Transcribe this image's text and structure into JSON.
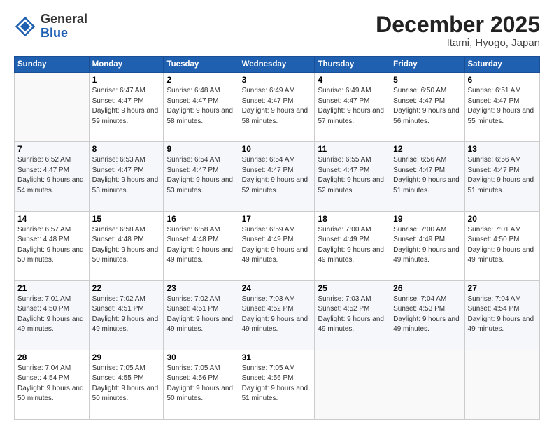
{
  "header": {
    "logo_general": "General",
    "logo_blue": "Blue",
    "month_title": "December 2025",
    "location": "Itami, Hyogo, Japan"
  },
  "weekdays": [
    "Sunday",
    "Monday",
    "Tuesday",
    "Wednesday",
    "Thursday",
    "Friday",
    "Saturday"
  ],
  "weeks": [
    [
      {
        "day": "",
        "sunrise": "",
        "sunset": "",
        "daylight": ""
      },
      {
        "day": "1",
        "sunrise": "Sunrise: 6:47 AM",
        "sunset": "Sunset: 4:47 PM",
        "daylight": "Daylight: 9 hours and 59 minutes."
      },
      {
        "day": "2",
        "sunrise": "Sunrise: 6:48 AM",
        "sunset": "Sunset: 4:47 PM",
        "daylight": "Daylight: 9 hours and 58 minutes."
      },
      {
        "day": "3",
        "sunrise": "Sunrise: 6:49 AM",
        "sunset": "Sunset: 4:47 PM",
        "daylight": "Daylight: 9 hours and 58 minutes."
      },
      {
        "day": "4",
        "sunrise": "Sunrise: 6:49 AM",
        "sunset": "Sunset: 4:47 PM",
        "daylight": "Daylight: 9 hours and 57 minutes."
      },
      {
        "day": "5",
        "sunrise": "Sunrise: 6:50 AM",
        "sunset": "Sunset: 4:47 PM",
        "daylight": "Daylight: 9 hours and 56 minutes."
      },
      {
        "day": "6",
        "sunrise": "Sunrise: 6:51 AM",
        "sunset": "Sunset: 4:47 PM",
        "daylight": "Daylight: 9 hours and 55 minutes."
      }
    ],
    [
      {
        "day": "7",
        "sunrise": "Sunrise: 6:52 AM",
        "sunset": "Sunset: 4:47 PM",
        "daylight": "Daylight: 9 hours and 54 minutes."
      },
      {
        "day": "8",
        "sunrise": "Sunrise: 6:53 AM",
        "sunset": "Sunset: 4:47 PM",
        "daylight": "Daylight: 9 hours and 53 minutes."
      },
      {
        "day": "9",
        "sunrise": "Sunrise: 6:54 AM",
        "sunset": "Sunset: 4:47 PM",
        "daylight": "Daylight: 9 hours and 53 minutes."
      },
      {
        "day": "10",
        "sunrise": "Sunrise: 6:54 AM",
        "sunset": "Sunset: 4:47 PM",
        "daylight": "Daylight: 9 hours and 52 minutes."
      },
      {
        "day": "11",
        "sunrise": "Sunrise: 6:55 AM",
        "sunset": "Sunset: 4:47 PM",
        "daylight": "Daylight: 9 hours and 52 minutes."
      },
      {
        "day": "12",
        "sunrise": "Sunrise: 6:56 AM",
        "sunset": "Sunset: 4:47 PM",
        "daylight": "Daylight: 9 hours and 51 minutes."
      },
      {
        "day": "13",
        "sunrise": "Sunrise: 6:56 AM",
        "sunset": "Sunset: 4:47 PM",
        "daylight": "Daylight: 9 hours and 51 minutes."
      }
    ],
    [
      {
        "day": "14",
        "sunrise": "Sunrise: 6:57 AM",
        "sunset": "Sunset: 4:48 PM",
        "daylight": "Daylight: 9 hours and 50 minutes."
      },
      {
        "day": "15",
        "sunrise": "Sunrise: 6:58 AM",
        "sunset": "Sunset: 4:48 PM",
        "daylight": "Daylight: 9 hours and 50 minutes."
      },
      {
        "day": "16",
        "sunrise": "Sunrise: 6:58 AM",
        "sunset": "Sunset: 4:48 PM",
        "daylight": "Daylight: 9 hours and 49 minutes."
      },
      {
        "day": "17",
        "sunrise": "Sunrise: 6:59 AM",
        "sunset": "Sunset: 4:49 PM",
        "daylight": "Daylight: 9 hours and 49 minutes."
      },
      {
        "day": "18",
        "sunrise": "Sunrise: 7:00 AM",
        "sunset": "Sunset: 4:49 PM",
        "daylight": "Daylight: 9 hours and 49 minutes."
      },
      {
        "day": "19",
        "sunrise": "Sunrise: 7:00 AM",
        "sunset": "Sunset: 4:49 PM",
        "daylight": "Daylight: 9 hours and 49 minutes."
      },
      {
        "day": "20",
        "sunrise": "Sunrise: 7:01 AM",
        "sunset": "Sunset: 4:50 PM",
        "daylight": "Daylight: 9 hours and 49 minutes."
      }
    ],
    [
      {
        "day": "21",
        "sunrise": "Sunrise: 7:01 AM",
        "sunset": "Sunset: 4:50 PM",
        "daylight": "Daylight: 9 hours and 49 minutes."
      },
      {
        "day": "22",
        "sunrise": "Sunrise: 7:02 AM",
        "sunset": "Sunset: 4:51 PM",
        "daylight": "Daylight: 9 hours and 49 minutes."
      },
      {
        "day": "23",
        "sunrise": "Sunrise: 7:02 AM",
        "sunset": "Sunset: 4:51 PM",
        "daylight": "Daylight: 9 hours and 49 minutes."
      },
      {
        "day": "24",
        "sunrise": "Sunrise: 7:03 AM",
        "sunset": "Sunset: 4:52 PM",
        "daylight": "Daylight: 9 hours and 49 minutes."
      },
      {
        "day": "25",
        "sunrise": "Sunrise: 7:03 AM",
        "sunset": "Sunset: 4:52 PM",
        "daylight": "Daylight: 9 hours and 49 minutes."
      },
      {
        "day": "26",
        "sunrise": "Sunrise: 7:04 AM",
        "sunset": "Sunset: 4:53 PM",
        "daylight": "Daylight: 9 hours and 49 minutes."
      },
      {
        "day": "27",
        "sunrise": "Sunrise: 7:04 AM",
        "sunset": "Sunset: 4:54 PM",
        "daylight": "Daylight: 9 hours and 49 minutes."
      }
    ],
    [
      {
        "day": "28",
        "sunrise": "Sunrise: 7:04 AM",
        "sunset": "Sunset: 4:54 PM",
        "daylight": "Daylight: 9 hours and 50 minutes."
      },
      {
        "day": "29",
        "sunrise": "Sunrise: 7:05 AM",
        "sunset": "Sunset: 4:55 PM",
        "daylight": "Daylight: 9 hours and 50 minutes."
      },
      {
        "day": "30",
        "sunrise": "Sunrise: 7:05 AM",
        "sunset": "Sunset: 4:56 PM",
        "daylight": "Daylight: 9 hours and 50 minutes."
      },
      {
        "day": "31",
        "sunrise": "Sunrise: 7:05 AM",
        "sunset": "Sunset: 4:56 PM",
        "daylight": "Daylight: 9 hours and 51 minutes."
      },
      {
        "day": "",
        "sunrise": "",
        "sunset": "",
        "daylight": ""
      },
      {
        "day": "",
        "sunrise": "",
        "sunset": "",
        "daylight": ""
      },
      {
        "day": "",
        "sunrise": "",
        "sunset": "",
        "daylight": ""
      }
    ]
  ]
}
